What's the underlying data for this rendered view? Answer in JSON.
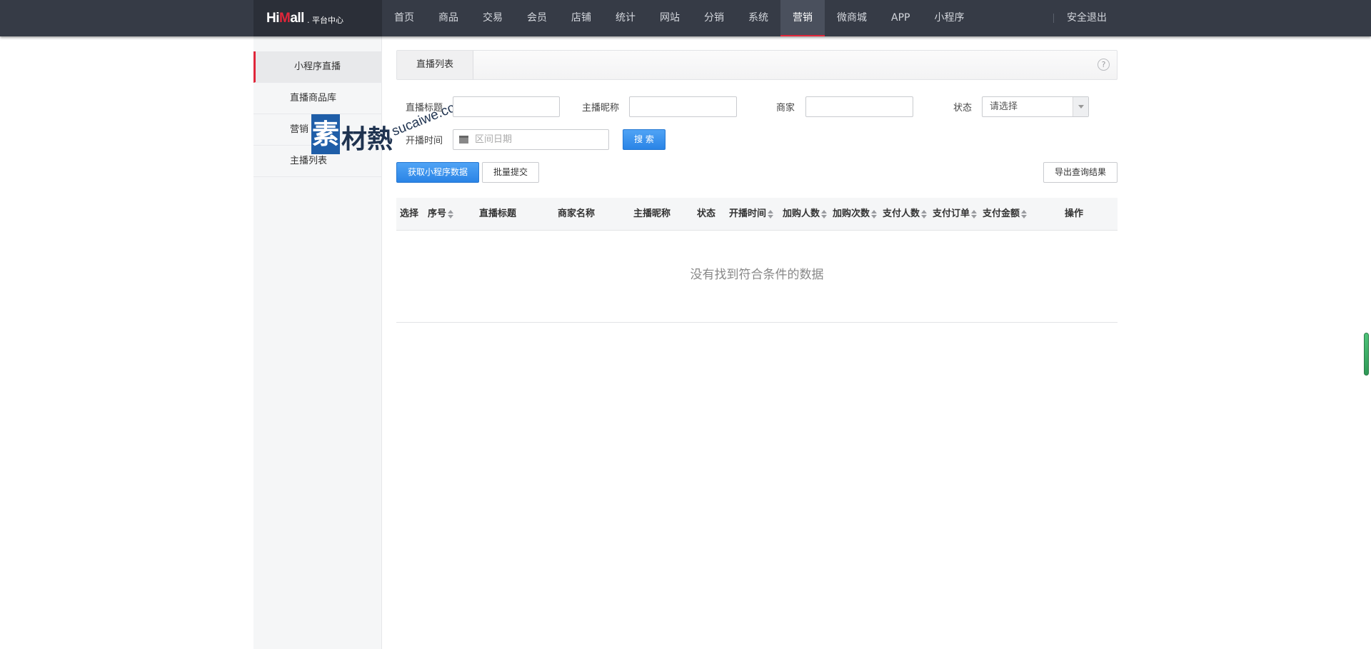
{
  "header": {
    "logo_text_a": "Hi",
    "logo_text_m": "M",
    "logo_text_b": "all",
    "logo_sub": ". 平台中心",
    "nav": [
      {
        "label": "首页",
        "name": "nav-home"
      },
      {
        "label": "商品",
        "name": "nav-products"
      },
      {
        "label": "交易",
        "name": "nav-trade"
      },
      {
        "label": "会员",
        "name": "nav-members"
      },
      {
        "label": "店铺",
        "name": "nav-shops"
      },
      {
        "label": "统计",
        "name": "nav-stats"
      },
      {
        "label": "网站",
        "name": "nav-site"
      },
      {
        "label": "分销",
        "name": "nav-distribution"
      },
      {
        "label": "系统",
        "name": "nav-system"
      },
      {
        "label": "营销",
        "name": "nav-marketing"
      },
      {
        "label": "微商城",
        "name": "nav-wechat-mall"
      },
      {
        "label": "APP",
        "name": "nav-app"
      },
      {
        "label": "小程序",
        "name": "nav-miniprogram"
      }
    ],
    "active_nav": "营销",
    "logout": "安全退出"
  },
  "sidebar": {
    "items": [
      {
        "label": "小程序直播",
        "active": true
      },
      {
        "label": "直播商品库",
        "active": false
      },
      {
        "label": "营销",
        "active": false
      },
      {
        "label": "主播列表",
        "active": false
      }
    ]
  },
  "watermark": {
    "box_char": "素",
    "chars": "材熱",
    "url": "sucaiwe.com"
  },
  "main": {
    "tab": "直播列表",
    "help": "?",
    "filters": {
      "title_label": "直播标题",
      "anchor_label": "主播昵称",
      "merchant_label": "商家",
      "status_label": "状态",
      "status_value": "请选择",
      "time_label": "开播时间",
      "date_placeholder": "区间日期",
      "search_btn": "搜 索"
    },
    "actions": {
      "fetch": "获取小程序数据",
      "batch": "批量提交",
      "export": "导出查询结果"
    },
    "table": {
      "columns": [
        "选择",
        "序号",
        "直播标题",
        "商家名称",
        "主播昵称",
        "状态",
        "开播时间",
        "加购人数",
        "加购次数",
        "支付人数",
        "支付订单",
        "支付金额",
        "操作"
      ],
      "empty": "没有找到符合条件的数据"
    }
  }
}
